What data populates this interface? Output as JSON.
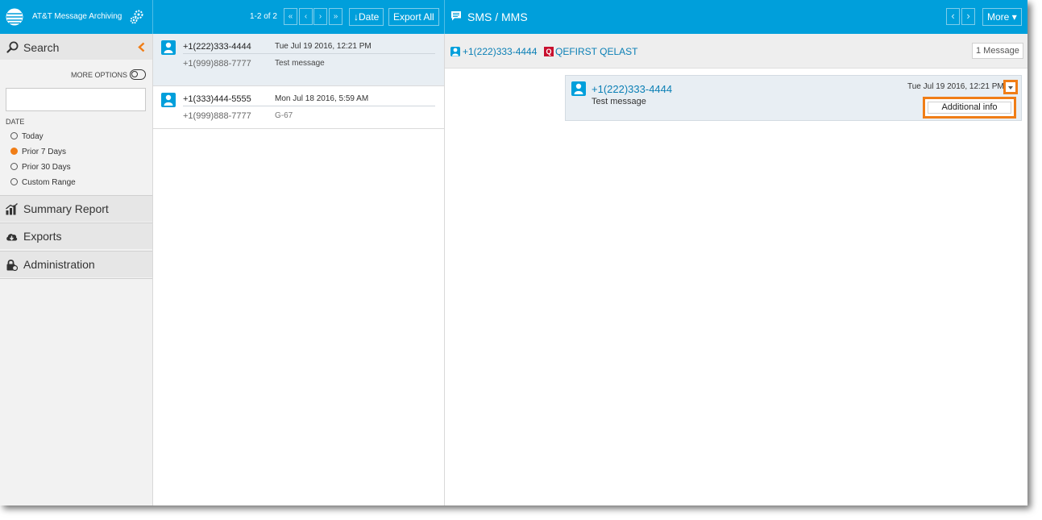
{
  "app": {
    "name": "AT&T Message Archiving"
  },
  "colors": {
    "brand_blue": "#009fdb",
    "accent_orange": "#f07d16",
    "link_blue": "#0a7fb5",
    "badge_red": "#c8102e"
  },
  "list_toolbar": {
    "count": "1-2 of 2",
    "first_icon": "«",
    "prev_icon": "‹",
    "next_icon": "›",
    "last_icon": "»",
    "sort_label": "Date",
    "sort_icon": "↓",
    "export_label": "Export All"
  },
  "view_toolbar": {
    "title": "SMS / MMS",
    "prev_icon": "‹",
    "next_icon": "›",
    "more_label": "More",
    "more_icon": "▾"
  },
  "sidebar": {
    "search_label": "Search",
    "more_options_label": "MORE OPTIONS",
    "search_value": "",
    "date_label": "DATE",
    "date_options": [
      {
        "label": "Today",
        "selected": false
      },
      {
        "label": "Prior 7 Days",
        "selected": true
      },
      {
        "label": "Prior 30 Days",
        "selected": false
      },
      {
        "label": "Custom Range",
        "selected": false
      }
    ],
    "nav": [
      {
        "label": "Summary Report",
        "icon": "bar-chart-icon"
      },
      {
        "label": "Exports",
        "icon": "cloud-download-icon"
      },
      {
        "label": "Administration",
        "icon": "lock-icon"
      }
    ]
  },
  "messages": [
    {
      "from": "+1(222)333-4444",
      "date": "Tue Jul 19 2016, 12:21 PM",
      "to": "+1(999)888-7777",
      "text": "Test message",
      "selected": true
    },
    {
      "from": "+1(333)444-5555",
      "date": "Mon Jul 18 2016, 5:59 AM",
      "to": "+1(999)888-7777",
      "text": "G-67",
      "selected": false
    }
  ],
  "conversation": {
    "participant_phone": "+1(222)333-4444",
    "participant_badge": "Q",
    "participant_name": "QEFIRST QELAST",
    "message_count": "1 Message",
    "message": {
      "phone": "+1(222)333-4444",
      "text": "Test message",
      "date": "Tue Jul 19 2016, 12:21 PM"
    },
    "dropdown_item": "Additional info"
  }
}
